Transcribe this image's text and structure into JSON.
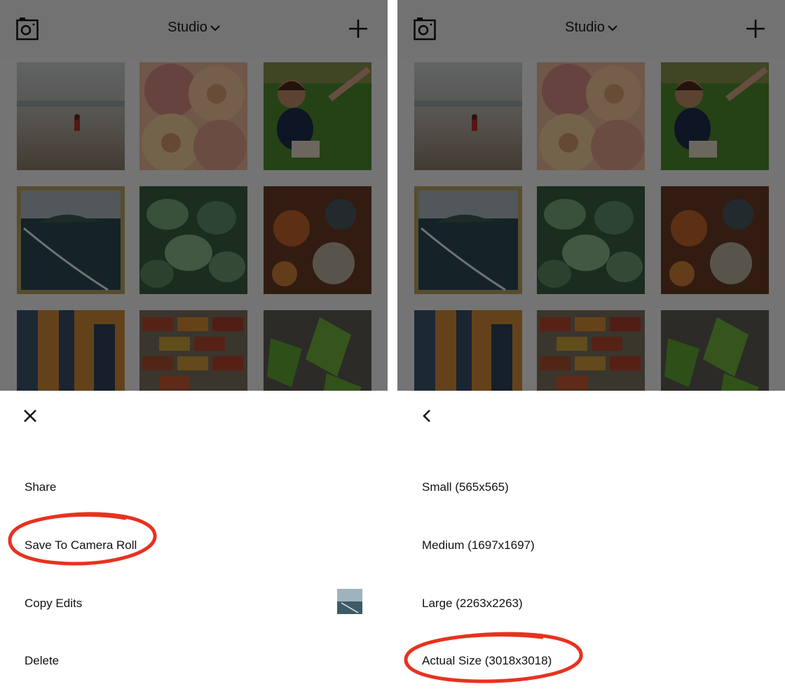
{
  "app": {
    "title": "Studio"
  },
  "left_panel": {
    "header": {
      "title": "Studio",
      "left_icon": "camera-icon",
      "right_icon": "plus-icon"
    },
    "sheet": {
      "close_icon": "close-icon",
      "items": [
        "Share",
        "Save To Camera Roll",
        "Copy Edits",
        "Delete"
      ]
    }
  },
  "right_panel": {
    "header": {
      "title": "Studio",
      "left_icon": "camera-icon",
      "right_icon": "plus-icon"
    },
    "sheet": {
      "back_icon": "back-chevron-icon",
      "items": [
        "Small (565x565)",
        "Medium (1697x1697)",
        "Large (2263x2263)",
        "Actual Size (3018x3018)"
      ]
    }
  },
  "colors": {
    "highlight_circle": "#e8321e",
    "selected_border": "#b7a160",
    "overlay": "rgba(0,0,0,0.52)"
  }
}
